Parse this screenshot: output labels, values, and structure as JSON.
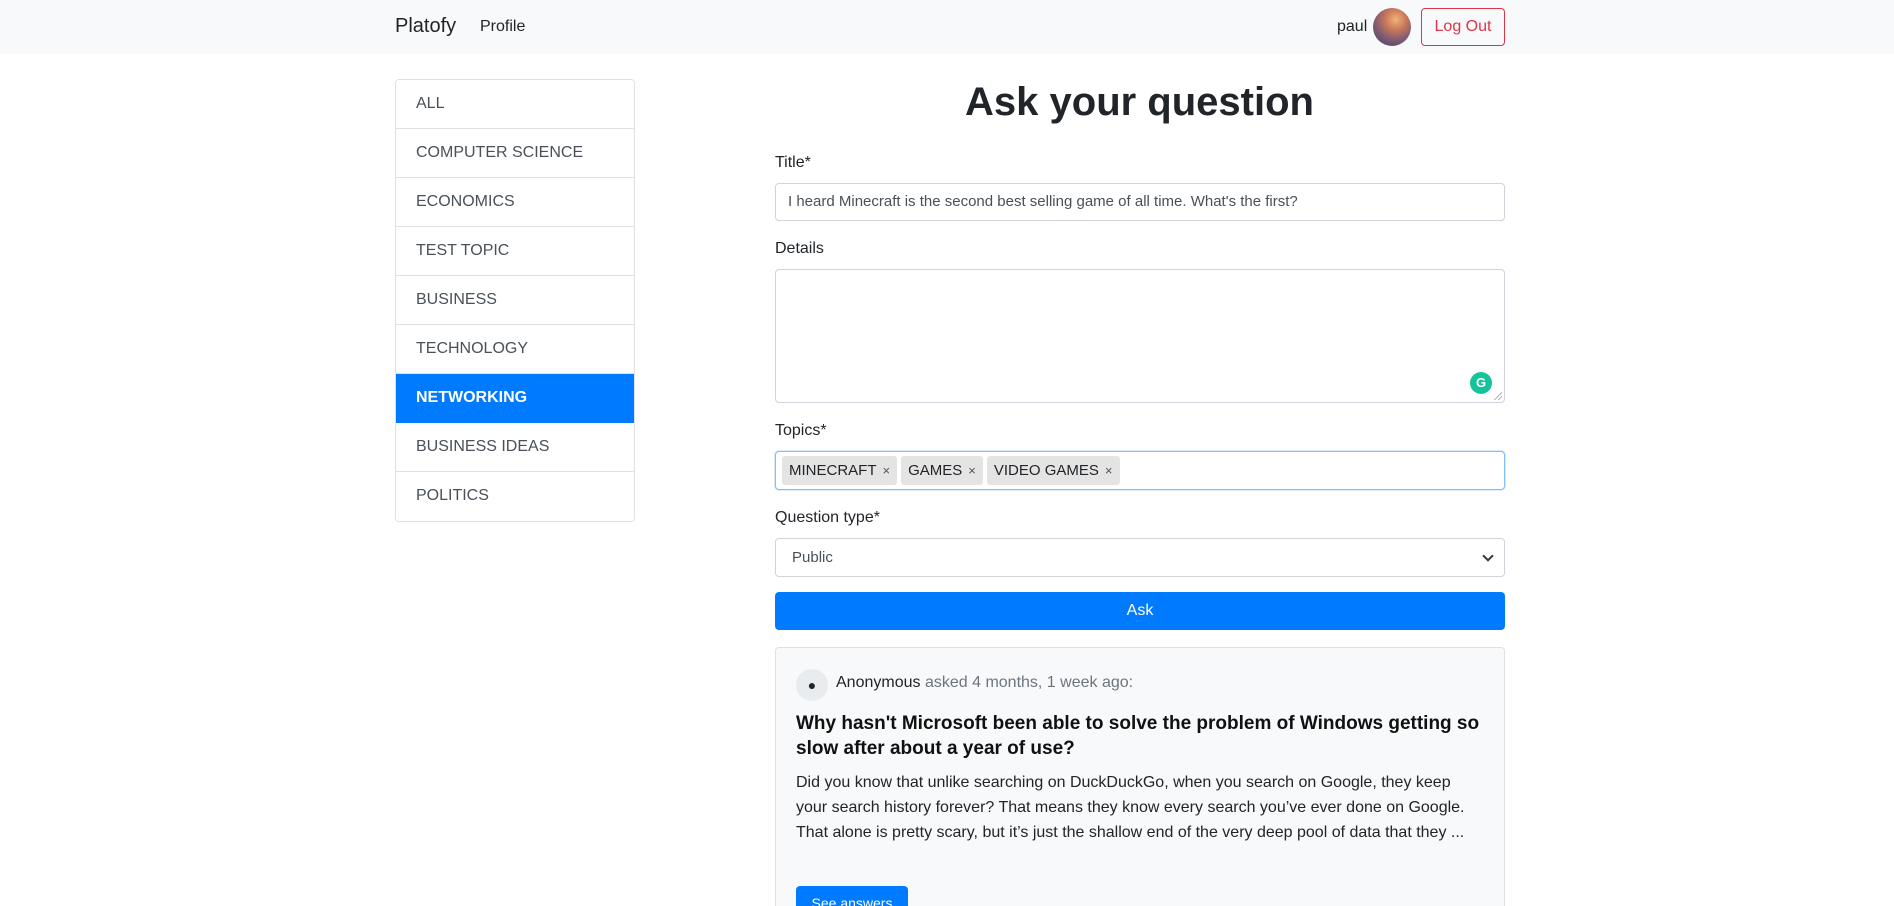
{
  "navbar": {
    "brand": "Platofy",
    "profile_link": "Profile",
    "username": "paul",
    "logout_label": "Log Out"
  },
  "sidebar": {
    "items": [
      {
        "label": "ALL",
        "active": false
      },
      {
        "label": "COMPUTER SCIENCE",
        "active": false
      },
      {
        "label": "ECONOMICS",
        "active": false
      },
      {
        "label": "TEST TOPIC",
        "active": false
      },
      {
        "label": "BUSINESS",
        "active": false
      },
      {
        "label": "TECHNOLOGY",
        "active": false
      },
      {
        "label": "NETWORKING",
        "active": true
      },
      {
        "label": "BUSINESS IDEAS",
        "active": false
      },
      {
        "label": "POLITICS",
        "active": false
      }
    ]
  },
  "form": {
    "heading": "Ask your question",
    "title_label": "Title*",
    "title_value": "I heard Minecraft is the second best selling game of all time. What's the first?",
    "details_label": "Details",
    "details_value": "",
    "topics_label": "Topics*",
    "topics": [
      "MINECRAFT",
      "GAMES",
      "VIDEO GAMES"
    ],
    "tag_remove": "×",
    "question_type_label": "Question type*",
    "question_type_value": "Public",
    "ask_label": "Ask"
  },
  "question_card": {
    "author": "Anonymous",
    "asked_text": "asked 4 months, 1 week ago:",
    "title": "Why hasn't Microsoft been able to solve the problem of Windows getting so slow after about a year of use?",
    "body": "Did you know that unlike searching on DuckDuckGo, when you search on Google, they keep your search history forever? That means they know every search you’ve ever done on Google. That alone is pretty scary, but it’s just the shallow end of the very deep pool of data that they ...",
    "see_answers_label": "See answers"
  },
  "colors": {
    "primary": "#007bff",
    "danger": "#dc3545",
    "navbar_bg": "#f8f9fa",
    "grammarly": "#15c39a"
  }
}
